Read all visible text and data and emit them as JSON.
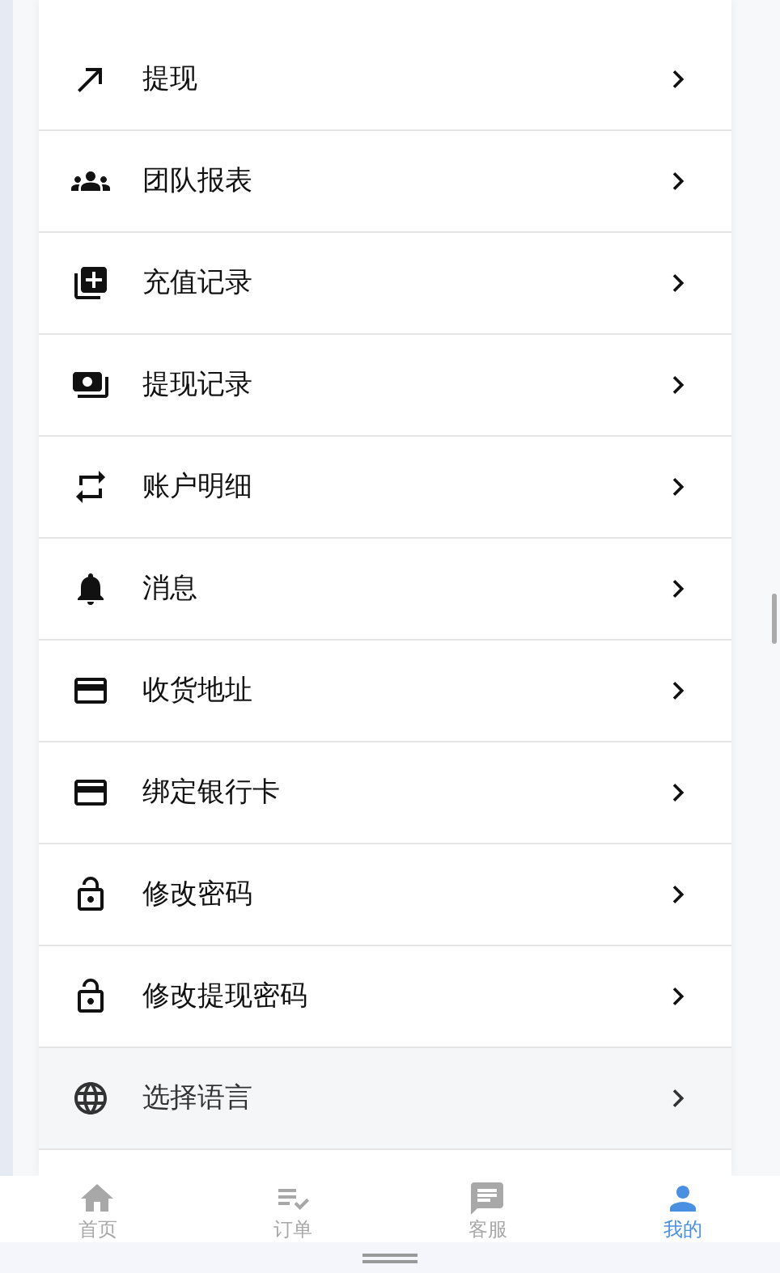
{
  "menu": [
    {
      "label": "提现",
      "selected": false
    },
    {
      "label": "团队报表",
      "selected": false
    },
    {
      "label": "充值记录",
      "selected": false
    },
    {
      "label": "提现记录",
      "selected": false
    },
    {
      "label": "账户明细",
      "selected": false
    },
    {
      "label": "消息",
      "selected": false
    },
    {
      "label": "收货地址",
      "selected": false
    },
    {
      "label": "绑定银行卡",
      "selected": false
    },
    {
      "label": "修改密码",
      "selected": false
    },
    {
      "label": "修改提现密码",
      "selected": false
    },
    {
      "label": "选择语言",
      "selected": true
    }
  ],
  "bottom_nav": [
    {
      "label": "首页",
      "selected": false
    },
    {
      "label": "订单",
      "selected": false
    },
    {
      "label": "客服",
      "selected": false
    },
    {
      "label": "我的",
      "selected": true
    }
  ]
}
